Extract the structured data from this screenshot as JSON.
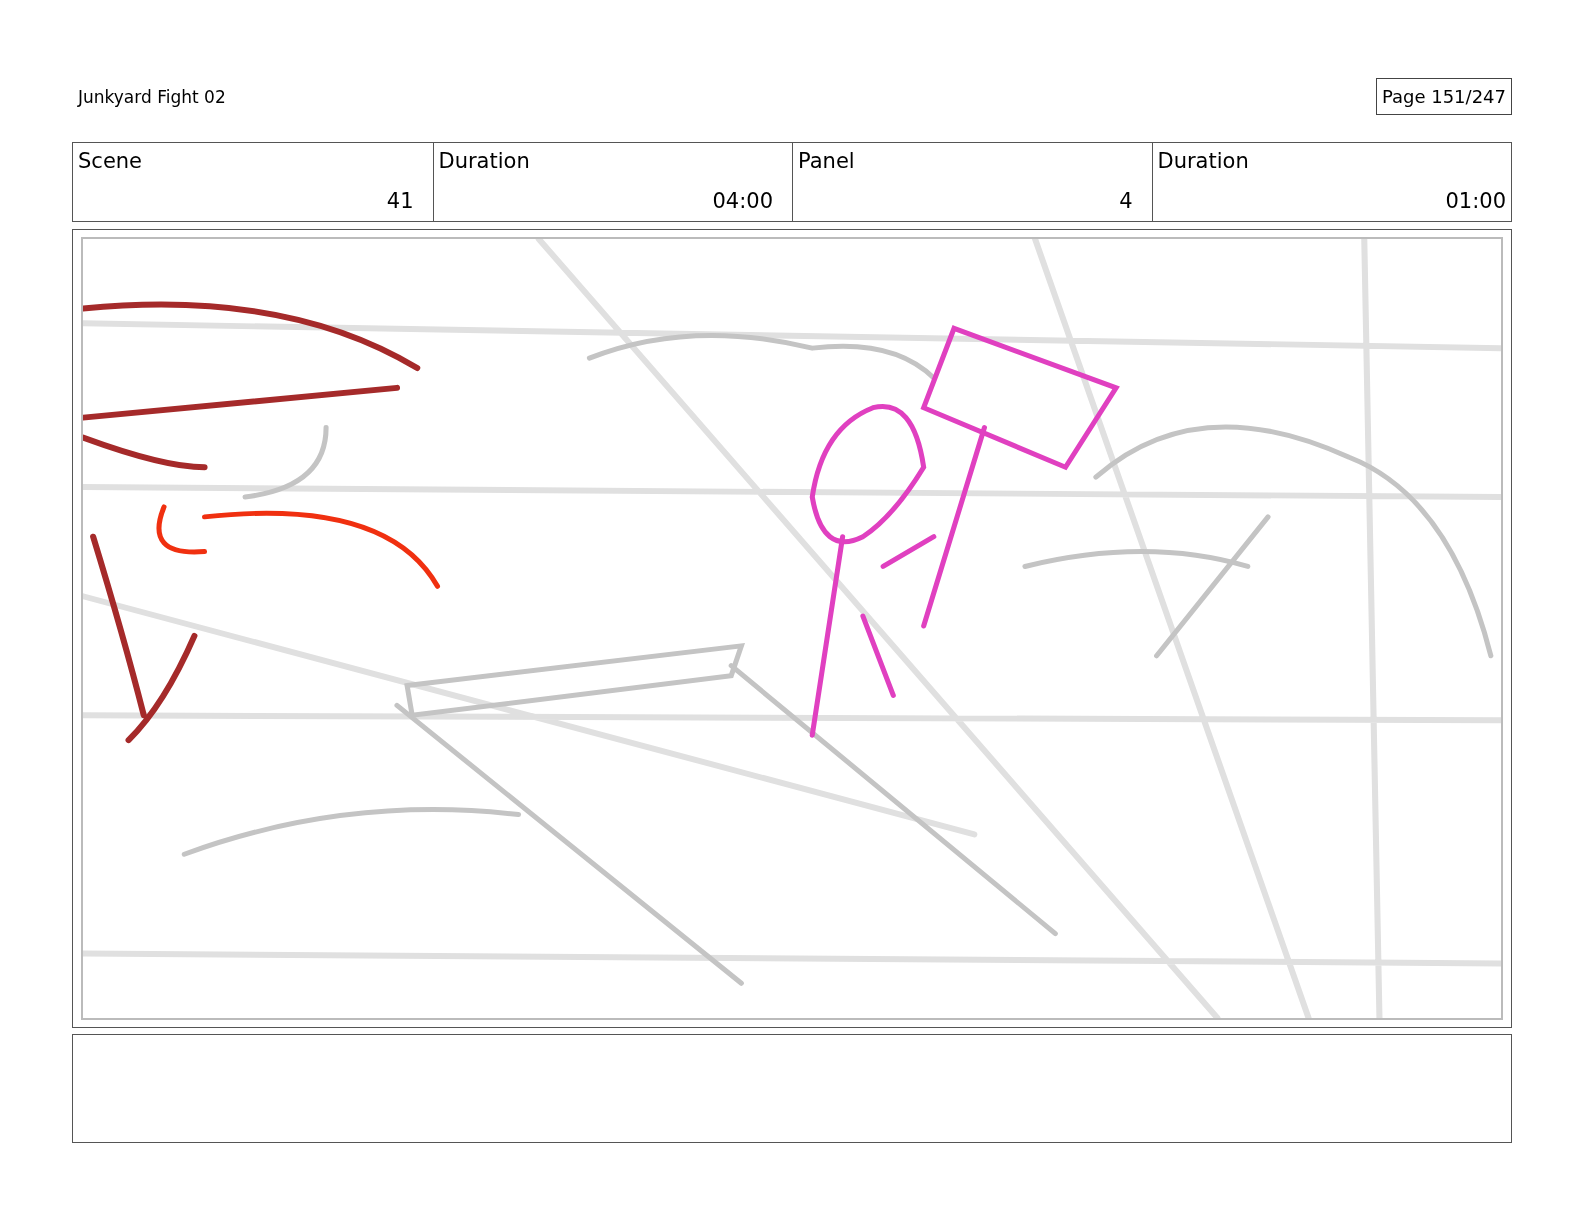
{
  "header": {
    "title": "Junkyard Fight 02",
    "page": "Page 151/247"
  },
  "info": [
    {
      "label": "Scene",
      "value": "41"
    },
    {
      "label": "Duration",
      "value": "04:00"
    },
    {
      "label": "Panel",
      "value": "4"
    },
    {
      "label": "Duration",
      "value": "01:00"
    }
  ],
  "panel": {
    "kind": "sketch"
  }
}
